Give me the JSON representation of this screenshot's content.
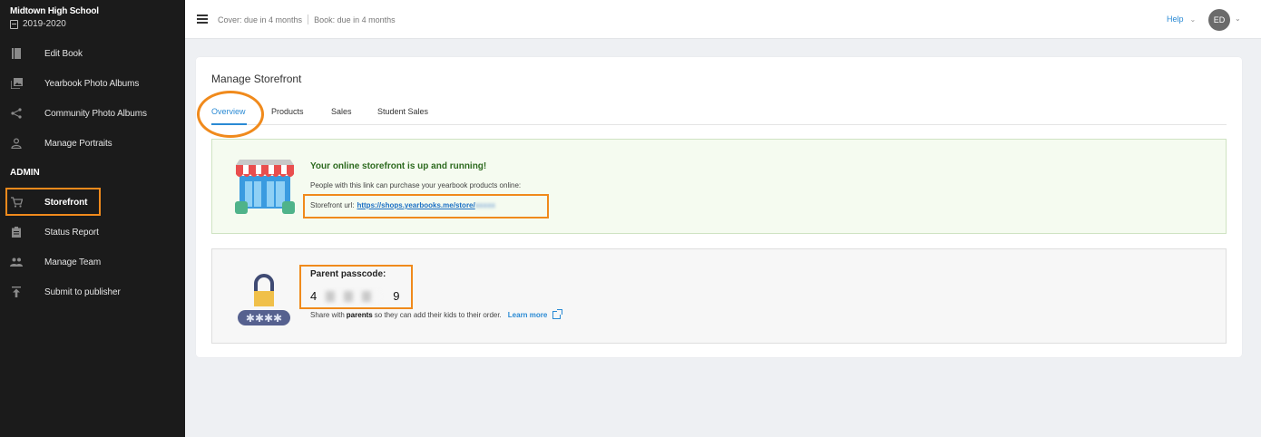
{
  "sidebar": {
    "school_name": "Midtown High School",
    "school_year": "2019-2020",
    "admin_label": "ADMIN",
    "items": [
      {
        "label": "Edit Book",
        "icon": "book-icon"
      },
      {
        "label": "Yearbook Photo Albums",
        "icon": "photo-album-icon"
      },
      {
        "label": "Community Photo Albums",
        "icon": "share-icon"
      },
      {
        "label": "Manage Portraits",
        "icon": "person-icon"
      },
      {
        "label": "Storefront",
        "icon": "cart-icon",
        "active": true
      },
      {
        "label": "Status Report",
        "icon": "clipboard-icon"
      },
      {
        "label": "Manage Team",
        "icon": "group-icon"
      },
      {
        "label": "Submit to publisher",
        "icon": "upload-icon"
      }
    ]
  },
  "topbar": {
    "cover_due": "Cover: due in 4 months",
    "book_due": "Book: due in 4 months",
    "help": "Help",
    "avatar_initials": "ED"
  },
  "main": {
    "title": "Manage Storefront",
    "tabs": [
      {
        "label": "Overview",
        "active": true
      },
      {
        "label": "Products"
      },
      {
        "label": "Sales"
      },
      {
        "label": "Student Sales"
      }
    ],
    "storefront": {
      "heading": "Your online storefront is up and running!",
      "subtext": "People with this link can purchase your yearbook products online:",
      "url_label": "Storefront url:",
      "url": "https://shops.yearbooks.me/store/",
      "url_redacted": "xxxxx"
    },
    "passcode": {
      "label": "Parent passcode:",
      "first_digit": "4",
      "last_digit": "9",
      "share_prefix": "Share with",
      "share_bold": "parents",
      "share_suffix": "so they can add their kids to their order.",
      "learn_more": "Learn more"
    }
  },
  "colors": {
    "accent": "#2a8ad4",
    "highlight": "#f08a1c",
    "success": "#2d6a1f",
    "sidebar_bg": "#1b1b1b"
  }
}
